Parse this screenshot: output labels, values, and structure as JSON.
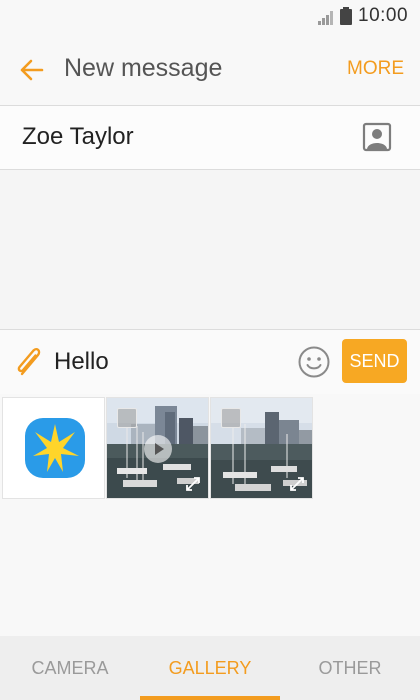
{
  "status_bar": {
    "time": "10:00",
    "icons": [
      "signal-icon",
      "battery-icon"
    ]
  },
  "header": {
    "title": "New message",
    "more_label": "MORE",
    "back_icon": "arrow-left-icon",
    "accent_color": "#f39c1f"
  },
  "recipient": {
    "name": "Zoe Taylor",
    "contact_icon": "contact-card-icon"
  },
  "composer": {
    "message_text": "Hello",
    "send_label": "SEND",
    "attach_icon": "paperclip-icon",
    "emoji_icon": "smiley-icon",
    "send_color": "#f7a823"
  },
  "gallery": {
    "items": [
      {
        "kind": "app",
        "icon": "gallery-app-icon"
      },
      {
        "kind": "video",
        "icons": [
          "select-checkbox-icon",
          "play-icon",
          "expand-icon"
        ]
      },
      {
        "kind": "photo",
        "icons": [
          "select-checkbox-icon",
          "expand-icon"
        ]
      }
    ]
  },
  "tabs": [
    {
      "label": "CAMERA",
      "active": false
    },
    {
      "label": "GALLERY",
      "active": true
    },
    {
      "label": "OTHER",
      "active": false
    }
  ]
}
